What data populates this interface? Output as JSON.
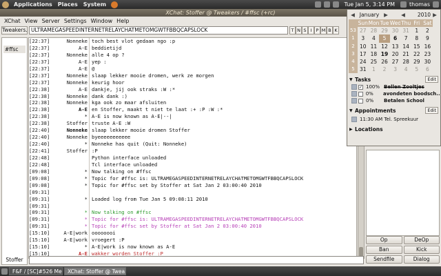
{
  "top_panel": {
    "menus": [
      "Applications",
      "Places",
      "System"
    ],
    "clock": "Tue Jan  5,  3:14 PM",
    "user": "thomas"
  },
  "window": {
    "title": "XChat: Stoffer @ Tweakers / #ffsc (+rc)",
    "menus": [
      "XChat",
      "View",
      "Server",
      "Settings",
      "Window",
      "Help"
    ],
    "server_tab": "Tweakers.",
    "channel": "#ffsc",
    "topic": "ULTRAMEGASPEEDINTERNETRELAYCHATMETOMGWTFBBQCAPSLOCK",
    "mode_buttons": [
      "T",
      "N",
      "S",
      "I",
      "P",
      "M",
      "B",
      "K"
    ],
    "nick": "Stoffer",
    "userlist_buttons": [
      "Op",
      "DeOp",
      "Ban",
      "Kick",
      "Sendfile",
      "Dialog"
    ]
  },
  "colors": {
    "system": "#111111",
    "join": "#2e9a2e",
    "topic": "#b63fb6",
    "highlight": "#c03030",
    "grey": "#888888"
  },
  "chat_lines": [
    {
      "ts": "[22:37]",
      "nick": "Nonneke",
      "msg": "toch best vlot gedaan ngo :p",
      "style": ""
    },
    {
      "ts": "[22:37]",
      "nick": "A-E",
      "msg": "beddietijd",
      "style": ""
    },
    {
      "ts": "[22:37]",
      "nick": "Nonneke",
      "msg": "alle 4 op ?",
      "style": ""
    },
    {
      "ts": "[22:37]",
      "nick": "A-E",
      "msg": "yep :",
      "style": ""
    },
    {
      "ts": "[22:37]",
      "nick": "A-E",
      "msg": "@",
      "style": ""
    },
    {
      "ts": "[22:37]",
      "nick": "Nonneke",
      "msg": "slaap lekker mooie dromen, werk ze morgen",
      "style": ""
    },
    {
      "ts": "[22:37]",
      "nick": "Nonneke",
      "msg": "keurig hoor",
      "style": ""
    },
    {
      "ts": "[22:38]",
      "nick": "A-E",
      "msg": "dankje, jij ook straks :W :*",
      "style": ""
    },
    {
      "ts": "[22:38]",
      "nick": "Nonneke",
      "msg": "dank dank :)",
      "style": ""
    },
    {
      "ts": "[22:38]",
      "nick": "Nonneke",
      "msg": "kga ook zo maar afsluiten",
      "style": ""
    },
    {
      "ts": "[22:38]",
      "nick": "A-E",
      "msg": "en Stoffer, maakt t niet te laat :+ :P :W :*",
      "style": "boldnick"
    },
    {
      "ts": "[22:38]",
      "nick": "*",
      "msg": "A-E is now known as A-E|--|",
      "style": ""
    },
    {
      "ts": "[22:38]",
      "nick": "Stoffer",
      "msg": "truste A-E :W",
      "style": ""
    },
    {
      "ts": "[22:40]",
      "nick": "Nonneke",
      "msg": "slaap lekker mooie dromen Stoffer",
      "style": "boldnick"
    },
    {
      "ts": "[22:40]",
      "nick": "Nonneke",
      "msg": "byeeeeeeeeeee",
      "style": ""
    },
    {
      "ts": "[22:40]",
      "nick": "*",
      "msg": "Nonneke has quit (Quit: Nonneke)",
      "style": ""
    },
    {
      "ts": "[22:41]",
      "nick": "Stoffer",
      "msg": ":P",
      "style": ""
    },
    {
      "ts": "[22:48]",
      "nick": "",
      "msg": "Python interface unloaded",
      "style": ""
    },
    {
      "ts": "[22:48]",
      "nick": "",
      "msg": "Tcl interface unloaded",
      "style": ""
    },
    {
      "ts": "[09:08]",
      "nick": "*",
      "msg": "Now talking on #ffsc",
      "style": ""
    },
    {
      "ts": "[09:08]",
      "nick": "*",
      "msg": "Topic for #ffsc is: ULTRAMEGASPEEDINTERNETRELAYCHATMETOMGWTFBBQCAPSLOCK",
      "style": ""
    },
    {
      "ts": "[09:08]",
      "nick": "*",
      "msg": "Topic for #ffsc set by Stoffer at Sat Jan  2 03:00:40 2010",
      "style": ""
    },
    {
      "ts": "[09:31]",
      "nick": "",
      "msg": "",
      "style": ""
    },
    {
      "ts": "[09:31]",
      "nick": "*",
      "msg": "Loaded log from Tue Jan  5 09:08:11 2010",
      "style": ""
    },
    {
      "ts": "[09:31]",
      "nick": "",
      "msg": "",
      "style": ""
    },
    {
      "ts": "[09:31]",
      "nick": "*",
      "msg": "Now talking on #ffsc",
      "style": "join"
    },
    {
      "ts": "[09:31]",
      "nick": "*",
      "msg": "Topic for #ffsc is: ULTRAMEGASPEEDINTERNETRELAYCHATMETOMGWTFBBQCAPSLOCK",
      "style": "topic"
    },
    {
      "ts": "[09:31]",
      "nick": "*",
      "msg": "Topic for #ffsc set by Stoffer at Sat Jan  2 03:00:40 2010",
      "style": "topic"
    },
    {
      "ts": "[15:10]",
      "nick": "A-E|work",
      "msg": "oooooooi",
      "style": ""
    },
    {
      "ts": "[15:10]",
      "nick": "A-E|work",
      "msg": "vroegert :P",
      "style": ""
    },
    {
      "ts": "[15:10]",
      "nick": "*",
      "msg": "A-E|work is now known as A-E",
      "style": ""
    },
    {
      "ts": "[15:10]",
      "nick": "A-E",
      "msg": "wakker worden Stoffer :P",
      "style": "highlight"
    },
    {
      "ts": "[15:12]",
      "nick": "Stoffer",
      "msg": ":D",
      "style": "grey"
    },
    {
      "ts": "[15:12]",
      "nick": "A-E",
      "msg": ":D",
      "style": "marker"
    }
  ],
  "calendar": {
    "month": "January",
    "year": "2010",
    "weekdays": [
      "Sun",
      "Mon",
      "Tue",
      "Wed",
      "Thu",
      "Fri",
      "Sat"
    ],
    "weeks": [
      {
        "wk": "53",
        "days": [
          {
            "d": "27",
            "o": 1
          },
          {
            "d": "28",
            "o": 1
          },
          {
            "d": "29",
            "o": 1
          },
          {
            "d": "30",
            "o": 1
          },
          {
            "d": "31",
            "o": 1
          },
          {
            "d": "1"
          },
          {
            "d": "2"
          }
        ]
      },
      {
        "wk": "1",
        "days": [
          {
            "d": "3"
          },
          {
            "d": "4"
          },
          {
            "d": "5",
            "s": 1
          },
          {
            "d": "6",
            "b": 1
          },
          {
            "d": "7"
          },
          {
            "d": "8"
          },
          {
            "d": "9"
          }
        ]
      },
      {
        "wk": "2",
        "days": [
          {
            "d": "10"
          },
          {
            "d": "11"
          },
          {
            "d": "12"
          },
          {
            "d": "13"
          },
          {
            "d": "14"
          },
          {
            "d": "15"
          },
          {
            "d": "16"
          }
        ]
      },
      {
        "wk": "3",
        "days": [
          {
            "d": "17"
          },
          {
            "d": "18"
          },
          {
            "d": "19",
            "b": 1
          },
          {
            "d": "20"
          },
          {
            "d": "21"
          },
          {
            "d": "22"
          },
          {
            "d": "23"
          }
        ]
      },
      {
        "wk": "4",
        "days": [
          {
            "d": "24"
          },
          {
            "d": "25"
          },
          {
            "d": "26"
          },
          {
            "d": "27"
          },
          {
            "d": "28"
          },
          {
            "d": "29"
          },
          {
            "d": "30"
          }
        ]
      },
      {
        "wk": "5",
        "days": [
          {
            "d": "31"
          },
          {
            "d": "1",
            "o": 1
          },
          {
            "d": "2",
            "o": 1
          },
          {
            "d": "3",
            "o": 1
          },
          {
            "d": "4",
            "o": 1
          },
          {
            "d": "5",
            "o": 1
          },
          {
            "d": "6",
            "o": 1
          }
        ]
      }
    ],
    "tasks_label": "Tasks",
    "edit_label": "Edit",
    "tasks": [
      {
        "checked": true,
        "pct": "100%",
        "name": "Bellen Zooltjes",
        "done": true
      },
      {
        "checked": false,
        "pct": "0%",
        "name": "avondeten boodsch...",
        "done": false
      },
      {
        "checked": false,
        "pct": "0%",
        "name": "Betalen School",
        "done": false
      }
    ],
    "appointments_label": "Appointments",
    "appointment": "11:30 AM  Tel. Spreekuur",
    "locations_label": "Locations"
  },
  "taskbar": {
    "items": [
      "F&F / [SC]#526 Met n...",
      "XChat: Stoffer @ Twea..."
    ]
  }
}
